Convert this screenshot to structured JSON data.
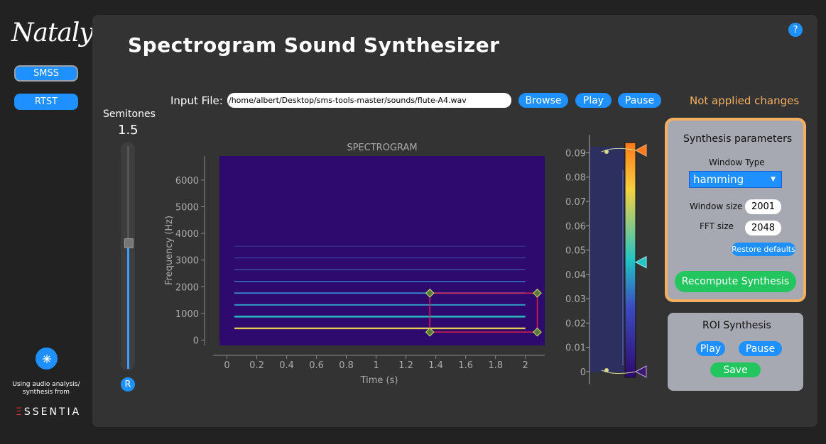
{
  "sidebar": {
    "logo": "Nataly",
    "nav": [
      {
        "label": "SMSS"
      },
      {
        "label": "RTST"
      }
    ],
    "using_text": "Using audio analysis/ synthesis from",
    "brand_e": "Ξ",
    "brand_rest": "SSENTIA",
    "settings_icon": "snowflake-icon"
  },
  "header": {
    "title": "Spectrogram Sound Synthesizer",
    "help": "?"
  },
  "input": {
    "label": "Input File:",
    "value": "/home/albert/Desktop/sms-tools-master/sounds/flute-A4.wav",
    "browse": "Browse",
    "play": "Play",
    "pause": "Pause"
  },
  "status": "Not applied changes",
  "semitones": {
    "label": "Semitones",
    "value": "1.5",
    "level": 0.57,
    "reset": "R"
  },
  "chart_data": [
    {
      "type": "heatmap",
      "title": "SPECTROGRAM",
      "xlabel": "Time (s)",
      "ylabel": "Frequency (Hz)",
      "xlim": [
        -0.05,
        2.13
      ],
      "ylim": [
        -200,
        6900
      ],
      "x_ticks": [
        "0",
        "0.2",
        "0.4",
        "0.6",
        "0.8",
        "1",
        "1.2",
        "1.4",
        "1.6",
        "1.8",
        "2"
      ],
      "y_ticks": [
        "0",
        "1000",
        "2000",
        "3000",
        "4000",
        "5000",
        "6000"
      ],
      "harmonics_hz": [
        440,
        880,
        1320,
        1760,
        2200,
        2640,
        3080,
        3520
      ],
      "harmonic_time_range": [
        0.05,
        2.0
      ],
      "roi": {
        "t0": 1.36,
        "t1": 2.08,
        "f0": 300,
        "f1": 1760
      },
      "colormap": [
        "#2e0a6e",
        "#3b4cc0",
        "#21c5c5",
        "#f5d040",
        "#ff7a1a"
      ]
    },
    {
      "type": "colorbar",
      "ticks": [
        "0",
        "0.01",
        "0.02",
        "0.03",
        "0.04",
        "0.05",
        "0.06",
        "0.07",
        "0.08",
        "0.09"
      ],
      "range": [
        0,
        0.091
      ],
      "markers": {
        "top": 0.091,
        "mid": 0.045,
        "bottom": 0
      }
    }
  ],
  "synth": {
    "title": "Synthesis parameters",
    "window_type_label": "Window Type",
    "window_type": "hamming",
    "window_size_label": "Window size",
    "window_size": "2001",
    "fft_size_label": "FFT size",
    "fft_size": "2048",
    "restore": "Restore defaults",
    "recompute": "Recompute Synthesis"
  },
  "roi": {
    "title": "ROI Synthesis",
    "play": "Play",
    "pause": "Pause",
    "save": "Save"
  }
}
